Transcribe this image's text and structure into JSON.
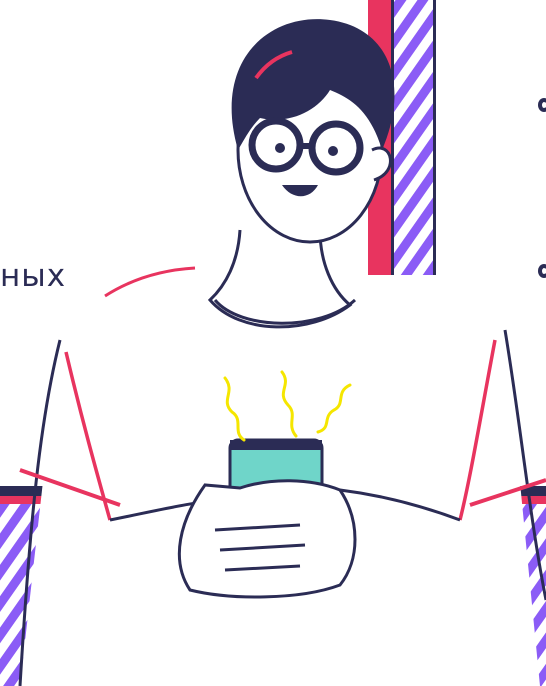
{
  "fragment_text": "ных",
  "colors": {
    "ink": "#2b2c55",
    "purple": "#8b5cf6",
    "pink": "#e8345f",
    "yellow": "#f5e600",
    "phone": "#6fd5c9",
    "skin": "#ffffff"
  },
  "icons": [
    "person-with-phone-illustration",
    "notification-vibration-icon"
  ]
}
